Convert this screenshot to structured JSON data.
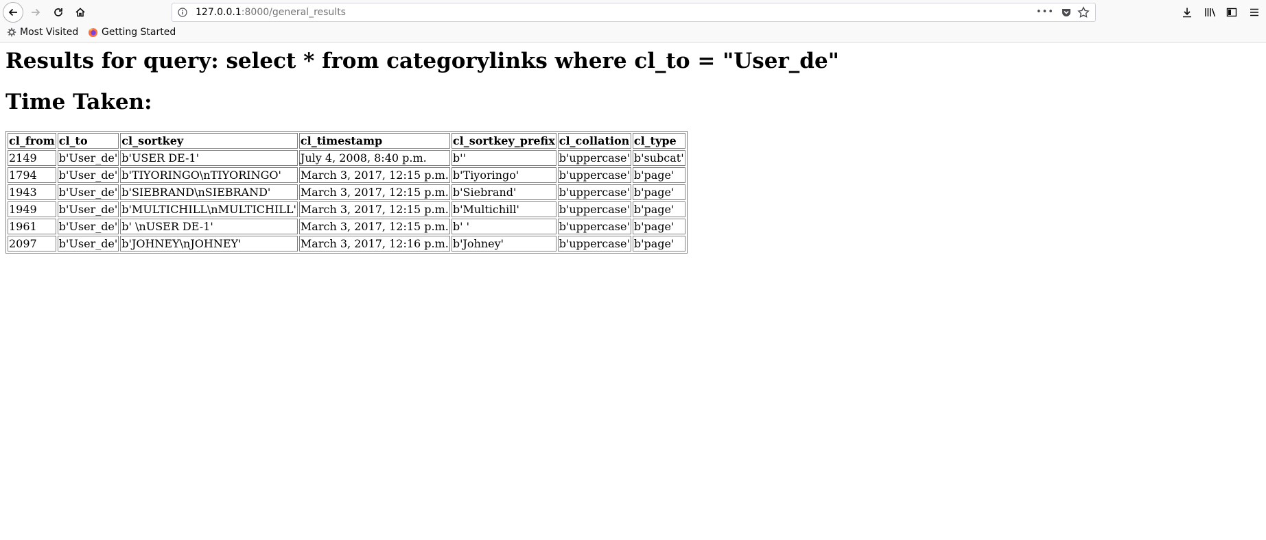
{
  "browser": {
    "url_host": "127.0.0.1",
    "url_path": ":8000/general_results",
    "url_menu": "•••",
    "bookmarks": [
      "Most Visited",
      "Getting Started"
    ]
  },
  "page": {
    "query_heading": "Results for query: select * from categorylinks where cl_to = \"User_de\"",
    "time_heading": "Time Taken:"
  },
  "table": {
    "headers": [
      "cl_from",
      "cl_to",
      "cl_sortkey",
      "cl_timestamp",
      "cl_sortkey_prefix",
      "cl_collation",
      "cl_type"
    ],
    "rows": [
      [
        "2149",
        "b'User_de'",
        "b'USER DE-1'",
        "July 4, 2008, 8:40 p.m.",
        "b''",
        "b'uppercase'",
        "b'subcat'"
      ],
      [
        "1794",
        "b'User_de'",
        "b'TIYORINGO\\nTIYORINGO'",
        "March 3, 2017, 12:15 p.m.",
        "b'Tiyoringo'",
        "b'uppercase'",
        "b'page'"
      ],
      [
        "1943",
        "b'User_de'",
        "b'SIEBRAND\\nSIEBRAND'",
        "March 3, 2017, 12:15 p.m.",
        "b'Siebrand'",
        "b'uppercase'",
        "b'page'"
      ],
      [
        "1949",
        "b'User_de'",
        "b'MULTICHILL\\nMULTICHILL'",
        "March 3, 2017, 12:15 p.m.",
        "b'Multichill'",
        "b'uppercase'",
        "b'page'"
      ],
      [
        "1961",
        "b'User_de'",
        "b' \\nUSER DE-1'",
        "March 3, 2017, 12:15 p.m.",
        "b' '",
        "b'uppercase'",
        "b'page'"
      ],
      [
        "2097",
        "b'User_de'",
        "b'JOHNEY\\nJOHNEY'",
        "March 3, 2017, 12:16 p.m.",
        "b'Johney'",
        "b'uppercase'",
        "b'page'"
      ]
    ]
  }
}
